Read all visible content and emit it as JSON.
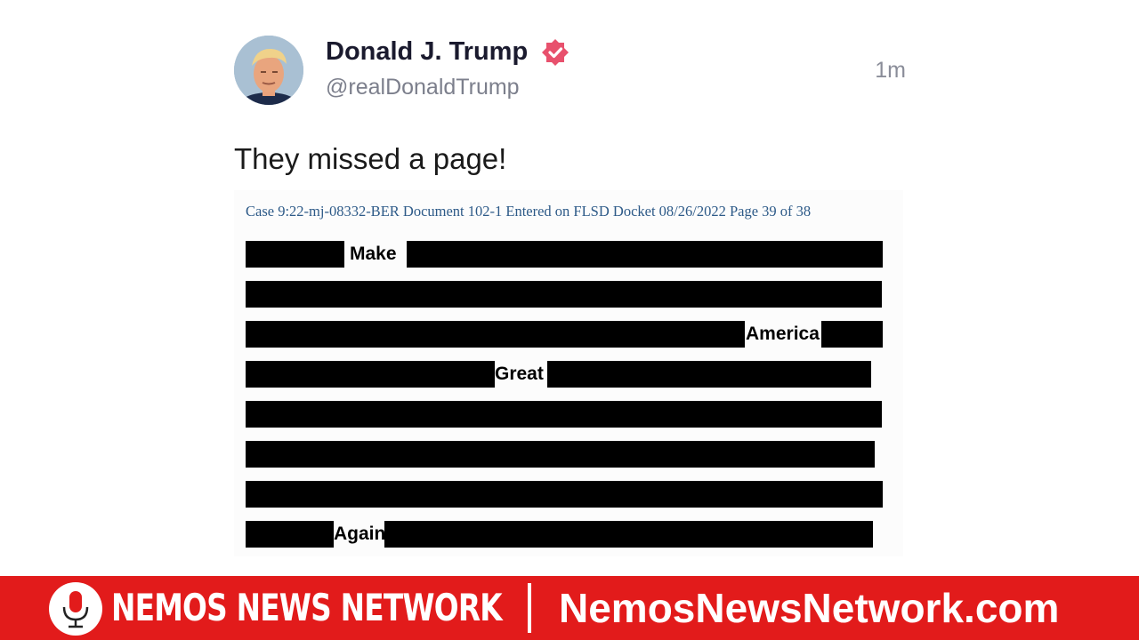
{
  "post": {
    "author_name": "Donald J. Trump",
    "handle": "@realDonaldTrump",
    "timestamp": "1m",
    "text": "They missed a page!",
    "verified_icon": "verified-badge-icon",
    "verified_color": "#e8516d"
  },
  "document": {
    "header": "Case 9:22-mj-08332-BER Document 102-1 Entered on FLSD Docket 08/26/2022 Page 39 of 38",
    "words": [
      "Make",
      "America",
      "Great",
      "Again"
    ],
    "redaction_color": "#000000"
  },
  "footer": {
    "brand": "NEMOS NEWS NETWORK",
    "url": "NemosNewsNetwork.com",
    "logo_icon": "microphone-icon",
    "background": "#e21b1b"
  }
}
